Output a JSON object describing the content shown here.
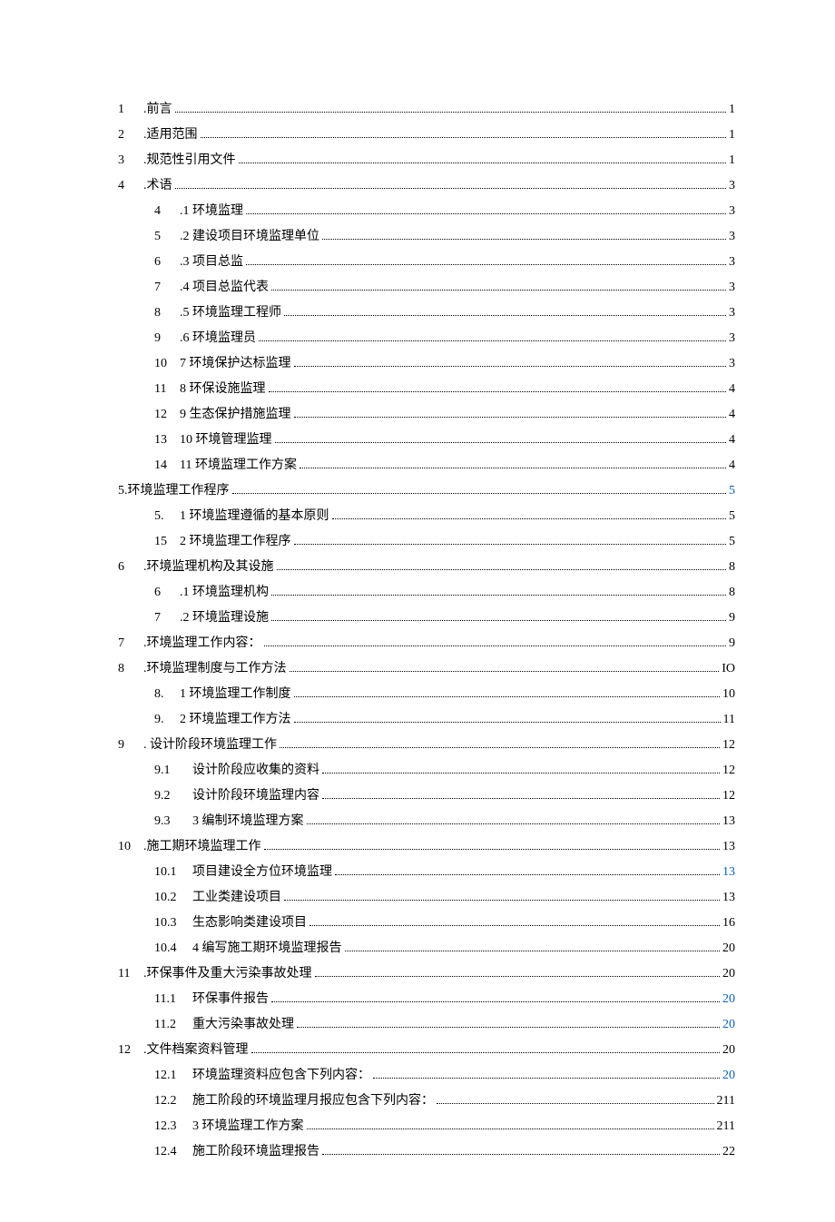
{
  "toc": [
    {
      "indent": 0,
      "num": "1",
      "title": ".前言",
      "page": "1",
      "link": false,
      "wide": false
    },
    {
      "indent": 0,
      "num": "2",
      "title": ".适用范围",
      "page": "1",
      "link": false,
      "wide": false
    },
    {
      "indent": 0,
      "num": "3",
      "title": ".规范性引用文件",
      "page": "1",
      "link": false,
      "wide": false
    },
    {
      "indent": 0,
      "num": "4",
      "title": ".术语",
      "page": "3",
      "link": false,
      "wide": false
    },
    {
      "indent": 1,
      "num": "4",
      "title": ".1 环境监理",
      "page": "3",
      "link": false,
      "wide": false
    },
    {
      "indent": 1,
      "num": "5",
      "title": ".2 建设项目环境监理单位",
      "page": "3",
      "link": false,
      "wide": false
    },
    {
      "indent": 1,
      "num": "6",
      "title": ".3 项目总监",
      "page": "3",
      "link": false,
      "wide": false
    },
    {
      "indent": 1,
      "num": "7",
      "title": ".4 项目总监代表",
      "page": "3",
      "link": false,
      "wide": false
    },
    {
      "indent": 1,
      "num": "8",
      "title": ".5 环境监理工程师",
      "page": "3",
      "link": false,
      "wide": false
    },
    {
      "indent": 1,
      "num": "9",
      "title": ".6 环境监理员",
      "page": "3",
      "link": false,
      "wide": false
    },
    {
      "indent": 1,
      "num": "10",
      "title": "7 环境保护达标监理",
      "page": "3",
      "link": false,
      "wide": false
    },
    {
      "indent": 1,
      "num": "11",
      "title": "8 环保设施监理",
      "page": "4",
      "link": false,
      "wide": false
    },
    {
      "indent": 1,
      "num": "12",
      "title": "9 生态保护措施监理",
      "page": "4",
      "link": false,
      "wide": false
    },
    {
      "indent": 1,
      "num": "13",
      "title": "10 环境管理监理",
      "page": "4",
      "link": false,
      "wide": false
    },
    {
      "indent": 1,
      "num": "14",
      "title": "11 环境监理工作方案",
      "page": "4",
      "link": false,
      "wide": false
    },
    {
      "indent": 0,
      "num": "",
      "title": "5.环境监理工作程序",
      "page": "5",
      "link": true,
      "wide": false,
      "nonum": true
    },
    {
      "indent": 1,
      "num": "5.",
      "title": "1 环境监理遵循的基本原则",
      "page": "5",
      "link": false,
      "wide": false
    },
    {
      "indent": 1,
      "num": "15",
      "title": "2 环境监理工作程序",
      "page": "5",
      "link": false,
      "wide": false
    },
    {
      "indent": 0,
      "num": "6",
      "title": ".环境监理机构及其设施",
      "page": "8",
      "link": false,
      "wide": false
    },
    {
      "indent": 1,
      "num": "6",
      "title": ".1 环境监理机构",
      "page": "8",
      "link": false,
      "wide": false
    },
    {
      "indent": 1,
      "num": "7",
      "title": ".2 环境监理设施",
      "page": "9",
      "link": false,
      "wide": false
    },
    {
      "indent": 0,
      "num": "7",
      "title": ".环境监理工作内容：",
      "page": "9",
      "link": false,
      "wide": false
    },
    {
      "indent": 0,
      "num": "8",
      "title": ".环境监理制度与工作方法",
      "page": "IO",
      "link": false,
      "wide": false
    },
    {
      "indent": 1,
      "num": "8.",
      "title": "1 环境监理工作制度",
      "page": "10",
      "link": false,
      "wide": false
    },
    {
      "indent": 1,
      "num": "9.",
      "title": "2 环境监理工作方法",
      "page": "11",
      "link": false,
      "wide": false
    },
    {
      "indent": 0,
      "num": "9",
      "title": ". 设计阶段环境监理工作",
      "page": "12",
      "link": false,
      "wide": false
    },
    {
      "indent": 1,
      "num": "9.1",
      "title": "设计阶段应收集的资料",
      "page": "12",
      "link": false,
      "wide": true
    },
    {
      "indent": 1,
      "num": "9.2",
      "title": "设计阶段环境监理内容",
      "page": "12",
      "link": false,
      "wide": true
    },
    {
      "indent": 1,
      "num": "9.3",
      "title": "3 编制环境监理方案",
      "page": "13",
      "link": false,
      "wide": true
    },
    {
      "indent": 0,
      "num": "10",
      "title": ".施工期环境监理工作",
      "page": "13",
      "link": false,
      "wide": false
    },
    {
      "indent": 1,
      "num": "10.1",
      "title": "项目建设全方位环境监理",
      "page": "13",
      "link": true,
      "wide": true
    },
    {
      "indent": 1,
      "num": "10.2",
      "title": "工业类建设项目",
      "page": "13",
      "link": false,
      "wide": true
    },
    {
      "indent": 1,
      "num": "10.3",
      "title": "生态影响类建设项目",
      "page": "16",
      "link": false,
      "wide": true
    },
    {
      "indent": 1,
      "num": "10.4",
      "title": "4 编写施工期环境监理报告",
      "page": "20",
      "link": false,
      "wide": true
    },
    {
      "indent": 0,
      "num": "11",
      "title": ".环保事件及重大污染事故处理",
      "page": "20",
      "link": false,
      "wide": false
    },
    {
      "indent": 1,
      "num": "11.1",
      "title": "环保事件报告",
      "page": "20",
      "link": true,
      "wide": true
    },
    {
      "indent": 1,
      "num": "11.2",
      "title": "重大污染事故处理",
      "page": "20",
      "link": true,
      "wide": true
    },
    {
      "indent": 0,
      "num": "12",
      "title": ".文件档案资料管理",
      "page": "20",
      "link": false,
      "wide": false
    },
    {
      "indent": 1,
      "num": "12.1",
      "title": "环境监理资料应包含下列内容：",
      "page": "20",
      "link": true,
      "wide": true
    },
    {
      "indent": 1,
      "num": "12.2",
      "title": "施工阶段的环境监理月报应包含下列内容：",
      "page": "211",
      "link": false,
      "wide": true
    },
    {
      "indent": 1,
      "num": "12.3",
      "title": "3 环境监理工作方案",
      "page": "211",
      "link": false,
      "wide": true
    },
    {
      "indent": 1,
      "num": "12.4",
      "title": "施工阶段环境监理报告",
      "page": "22",
      "link": false,
      "wide": true
    }
  ]
}
